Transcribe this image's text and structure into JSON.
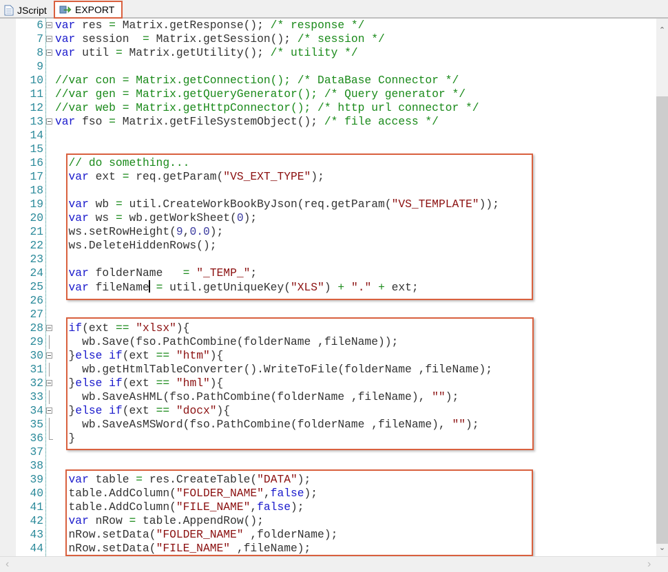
{
  "tabs": [
    {
      "label": "JScript",
      "icon": "document-icon"
    },
    {
      "label": "EXPORT",
      "icon": "export-icon",
      "active": true
    }
  ],
  "editor": {
    "lines": [
      {
        "n": "6",
        "fold": "minus",
        "t": [
          [
            "k",
            "var"
          ],
          [
            "t",
            " res "
          ],
          [
            "o",
            "="
          ],
          [
            "t",
            " Matrix.getResponse(); "
          ],
          [
            "c",
            "/* response */"
          ]
        ]
      },
      {
        "n": "7",
        "fold": "minus",
        "t": [
          [
            "k",
            "var"
          ],
          [
            "t",
            " session  "
          ],
          [
            "o",
            "="
          ],
          [
            "t",
            " Matrix.getSession(); "
          ],
          [
            "c",
            "/* session */"
          ]
        ]
      },
      {
        "n": "8",
        "fold": "minus",
        "t": [
          [
            "k",
            "var"
          ],
          [
            "t",
            " util "
          ],
          [
            "o",
            "="
          ],
          [
            "t",
            " Matrix.getUtility(); "
          ],
          [
            "c",
            "/* utility */"
          ]
        ]
      },
      {
        "n": "9",
        "t": []
      },
      {
        "n": "10",
        "t": [
          [
            "c",
            "//var con = Matrix.getConnection(); /* DataBase Connector */"
          ]
        ]
      },
      {
        "n": "11",
        "t": [
          [
            "c",
            "//var gen = Matrix.getQueryGenerator(); /* Query generator */"
          ]
        ]
      },
      {
        "n": "12",
        "t": [
          [
            "c",
            "//var web = Matrix.getHttpConnector(); /* http url connector */"
          ]
        ]
      },
      {
        "n": "13",
        "fold": "minus",
        "t": [
          [
            "k",
            "var"
          ],
          [
            "t",
            " fso "
          ],
          [
            "o",
            "="
          ],
          [
            "t",
            " Matrix.getFileSystemObject(); "
          ],
          [
            "c",
            "/* file access */"
          ]
        ]
      },
      {
        "n": "14",
        "t": []
      },
      {
        "n": "15",
        "t": []
      },
      {
        "n": "16",
        "t": [
          [
            "c",
            "  // do something..."
          ]
        ]
      },
      {
        "n": "17",
        "t": [
          [
            "k",
            "  var"
          ],
          [
            "t",
            " ext "
          ],
          [
            "o",
            "="
          ],
          [
            "t",
            " req.getParam("
          ],
          [
            "s",
            "\"VS_EXT_TYPE\""
          ],
          [
            "t",
            ");"
          ]
        ]
      },
      {
        "n": "18",
        "t": []
      },
      {
        "n": "19",
        "t": [
          [
            "k",
            "  var"
          ],
          [
            "t",
            " wb "
          ],
          [
            "o",
            "="
          ],
          [
            "t",
            " util.CreateWorkBookByJson(req.getParam("
          ],
          [
            "s",
            "\"VS_TEMPLATE\""
          ],
          [
            "t",
            "));"
          ]
        ]
      },
      {
        "n": "20",
        "t": [
          [
            "k",
            "  var"
          ],
          [
            "t",
            " ws "
          ],
          [
            "o",
            "="
          ],
          [
            "t",
            " wb.getWorkSheet("
          ],
          [
            "n",
            "0"
          ],
          [
            "t",
            ");"
          ]
        ]
      },
      {
        "n": "21",
        "t": [
          [
            "t",
            "  ws.setRowHeight("
          ],
          [
            "n",
            "9"
          ],
          [
            "t",
            ","
          ],
          [
            "n",
            "0.0"
          ],
          [
            "t",
            ");"
          ]
        ]
      },
      {
        "n": "22",
        "t": [
          [
            "t",
            "  ws.DeleteHiddenRows();"
          ]
        ]
      },
      {
        "n": "23",
        "t": []
      },
      {
        "n": "24",
        "t": [
          [
            "k",
            "  var"
          ],
          [
            "t",
            " folderName   "
          ],
          [
            "o",
            "="
          ],
          [
            "t",
            " "
          ],
          [
            "s",
            "\"_TEMP_\""
          ],
          [
            "t",
            ";"
          ]
        ]
      },
      {
        "n": "25",
        "t": [
          [
            "k",
            "  var"
          ],
          [
            "t",
            " fileName"
          ],
          [
            "caret",
            ""
          ],
          [
            "t",
            " "
          ],
          [
            "o",
            "="
          ],
          [
            "t",
            " util.getUniqueKey("
          ],
          [
            "s",
            "\"XLS\""
          ],
          [
            "t",
            ") "
          ],
          [
            "o",
            "+"
          ],
          [
            "t",
            " "
          ],
          [
            "s",
            "\".\""
          ],
          [
            "t",
            " "
          ],
          [
            "o",
            "+"
          ],
          [
            "t",
            " ext;"
          ]
        ]
      },
      {
        "n": "26",
        "t": []
      },
      {
        "n": "27",
        "t": []
      },
      {
        "n": "28",
        "fold": "minus",
        "t": [
          [
            "k",
            "  if"
          ],
          [
            "t",
            "(ext "
          ],
          [
            "o",
            "=="
          ],
          [
            "t",
            " "
          ],
          [
            "s",
            "\"xlsx\""
          ],
          [
            "t",
            "){"
          ]
        ]
      },
      {
        "n": "29",
        "fold": "bar",
        "t": [
          [
            "t",
            "    wb.Save(fso.PathCombine(folderName ,fileName));"
          ]
        ]
      },
      {
        "n": "30",
        "fold": "minus",
        "t": [
          [
            "t",
            "  }"
          ],
          [
            "k",
            "else if"
          ],
          [
            "t",
            "(ext "
          ],
          [
            "o",
            "=="
          ],
          [
            "t",
            " "
          ],
          [
            "s",
            "\"htm\""
          ],
          [
            "t",
            "){"
          ]
        ]
      },
      {
        "n": "31",
        "fold": "bar",
        "t": [
          [
            "t",
            "    wb.getHtmlTableConverter().WriteToFile(folderName ,fileName);"
          ]
        ]
      },
      {
        "n": "32",
        "fold": "minus",
        "t": [
          [
            "t",
            "  }"
          ],
          [
            "k",
            "else if"
          ],
          [
            "t",
            "(ext "
          ],
          [
            "o",
            "=="
          ],
          [
            "t",
            " "
          ],
          [
            "s",
            "\"hml\""
          ],
          [
            "t",
            "){"
          ]
        ]
      },
      {
        "n": "33",
        "fold": "bar",
        "t": [
          [
            "t",
            "    wb.SaveAsHML(fso.PathCombine(folderName ,fileName), "
          ],
          [
            "s",
            "\"\""
          ],
          [
            "t",
            ");"
          ]
        ]
      },
      {
        "n": "34",
        "fold": "minus",
        "t": [
          [
            "t",
            "  }"
          ],
          [
            "k",
            "else if"
          ],
          [
            "t",
            "(ext "
          ],
          [
            "o",
            "=="
          ],
          [
            "t",
            " "
          ],
          [
            "s",
            "\"docx\""
          ],
          [
            "t",
            "){"
          ]
        ]
      },
      {
        "n": "35",
        "fold": "bar",
        "t": [
          [
            "t",
            "    wb.SaveAsMSWord(fso.PathCombine(folderName ,fileName), "
          ],
          [
            "s",
            "\"\""
          ],
          [
            "t",
            ");"
          ]
        ]
      },
      {
        "n": "36",
        "fold": "end",
        "t": [
          [
            "t",
            "  }"
          ]
        ]
      },
      {
        "n": "37",
        "t": []
      },
      {
        "n": "38",
        "t": []
      },
      {
        "n": "39",
        "t": [
          [
            "k",
            "  var"
          ],
          [
            "t",
            " table "
          ],
          [
            "o",
            "="
          ],
          [
            "t",
            " res.CreateTable("
          ],
          [
            "s",
            "\"DATA\""
          ],
          [
            "t",
            ");"
          ]
        ]
      },
      {
        "n": "40",
        "t": [
          [
            "t",
            "  table.AddColumn("
          ],
          [
            "s",
            "\"FOLDER_NAME\""
          ],
          [
            "t",
            ","
          ],
          [
            "k",
            "false"
          ],
          [
            "t",
            ");"
          ]
        ]
      },
      {
        "n": "41",
        "t": [
          [
            "t",
            "  table.AddColumn("
          ],
          [
            "s",
            "\"FILE_NAME\""
          ],
          [
            "t",
            ","
          ],
          [
            "k",
            "false"
          ],
          [
            "t",
            ");"
          ]
        ]
      },
      {
        "n": "42",
        "t": [
          [
            "k",
            "  var"
          ],
          [
            "t",
            " nRow "
          ],
          [
            "o",
            "="
          ],
          [
            "t",
            " table.AppendRow();"
          ]
        ]
      },
      {
        "n": "43",
        "t": [
          [
            "t",
            "  nRow.setData("
          ],
          [
            "s",
            "\"FOLDER_NAME\""
          ],
          [
            "t",
            " ,folderName);"
          ]
        ]
      },
      {
        "n": "44",
        "t": [
          [
            "t",
            "  nRow.setData("
          ],
          [
            "s",
            "\"FILE_NAME\""
          ],
          [
            "t",
            " ,fileName);"
          ]
        ]
      }
    ]
  }
}
